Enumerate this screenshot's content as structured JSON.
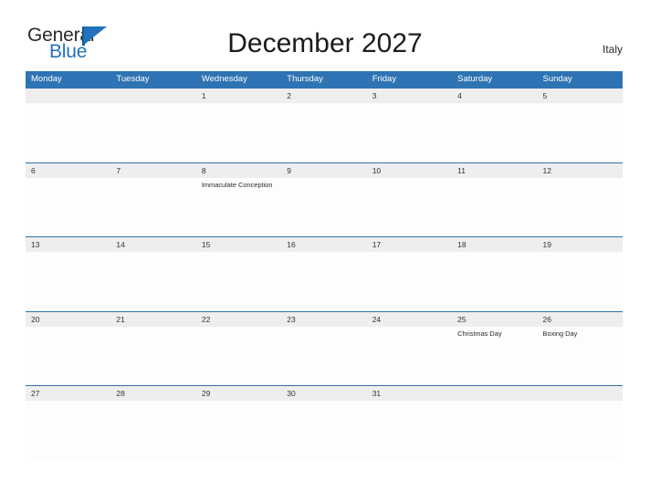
{
  "logo": {
    "word_one": "General",
    "word_two": "Blue",
    "triangle_color": "#2272bb",
    "icon": "triangle-right-icon"
  },
  "header": {
    "title": "December 2027",
    "country": "Italy",
    "accent_color": "#2e73b3",
    "date_band_color": "#eeeeee"
  },
  "calendar": {
    "weekdays": [
      "Monday",
      "Tuesday",
      "Wednesday",
      "Thursday",
      "Friday",
      "Saturday",
      "Sunday"
    ],
    "weeks": [
      [
        {
          "day": "",
          "event": ""
        },
        {
          "day": "",
          "event": ""
        },
        {
          "day": "1",
          "event": ""
        },
        {
          "day": "2",
          "event": ""
        },
        {
          "day": "3",
          "event": ""
        },
        {
          "day": "4",
          "event": ""
        },
        {
          "day": "5",
          "event": ""
        }
      ],
      [
        {
          "day": "6",
          "event": ""
        },
        {
          "day": "7",
          "event": ""
        },
        {
          "day": "8",
          "event": "Immaculate Conception"
        },
        {
          "day": "9",
          "event": ""
        },
        {
          "day": "10",
          "event": ""
        },
        {
          "day": "11",
          "event": ""
        },
        {
          "day": "12",
          "event": ""
        }
      ],
      [
        {
          "day": "13",
          "event": ""
        },
        {
          "day": "14",
          "event": ""
        },
        {
          "day": "15",
          "event": ""
        },
        {
          "day": "16",
          "event": ""
        },
        {
          "day": "17",
          "event": ""
        },
        {
          "day": "18",
          "event": ""
        },
        {
          "day": "19",
          "event": ""
        }
      ],
      [
        {
          "day": "20",
          "event": ""
        },
        {
          "day": "21",
          "event": ""
        },
        {
          "day": "22",
          "event": ""
        },
        {
          "day": "23",
          "event": ""
        },
        {
          "day": "24",
          "event": ""
        },
        {
          "day": "25",
          "event": "Christmas Day"
        },
        {
          "day": "26",
          "event": "Boxing Day"
        }
      ],
      [
        {
          "day": "27",
          "event": ""
        },
        {
          "day": "28",
          "event": ""
        },
        {
          "day": "29",
          "event": ""
        },
        {
          "day": "30",
          "event": ""
        },
        {
          "day": "31",
          "event": ""
        },
        {
          "day": "",
          "event": ""
        },
        {
          "day": "",
          "event": ""
        }
      ]
    ]
  }
}
